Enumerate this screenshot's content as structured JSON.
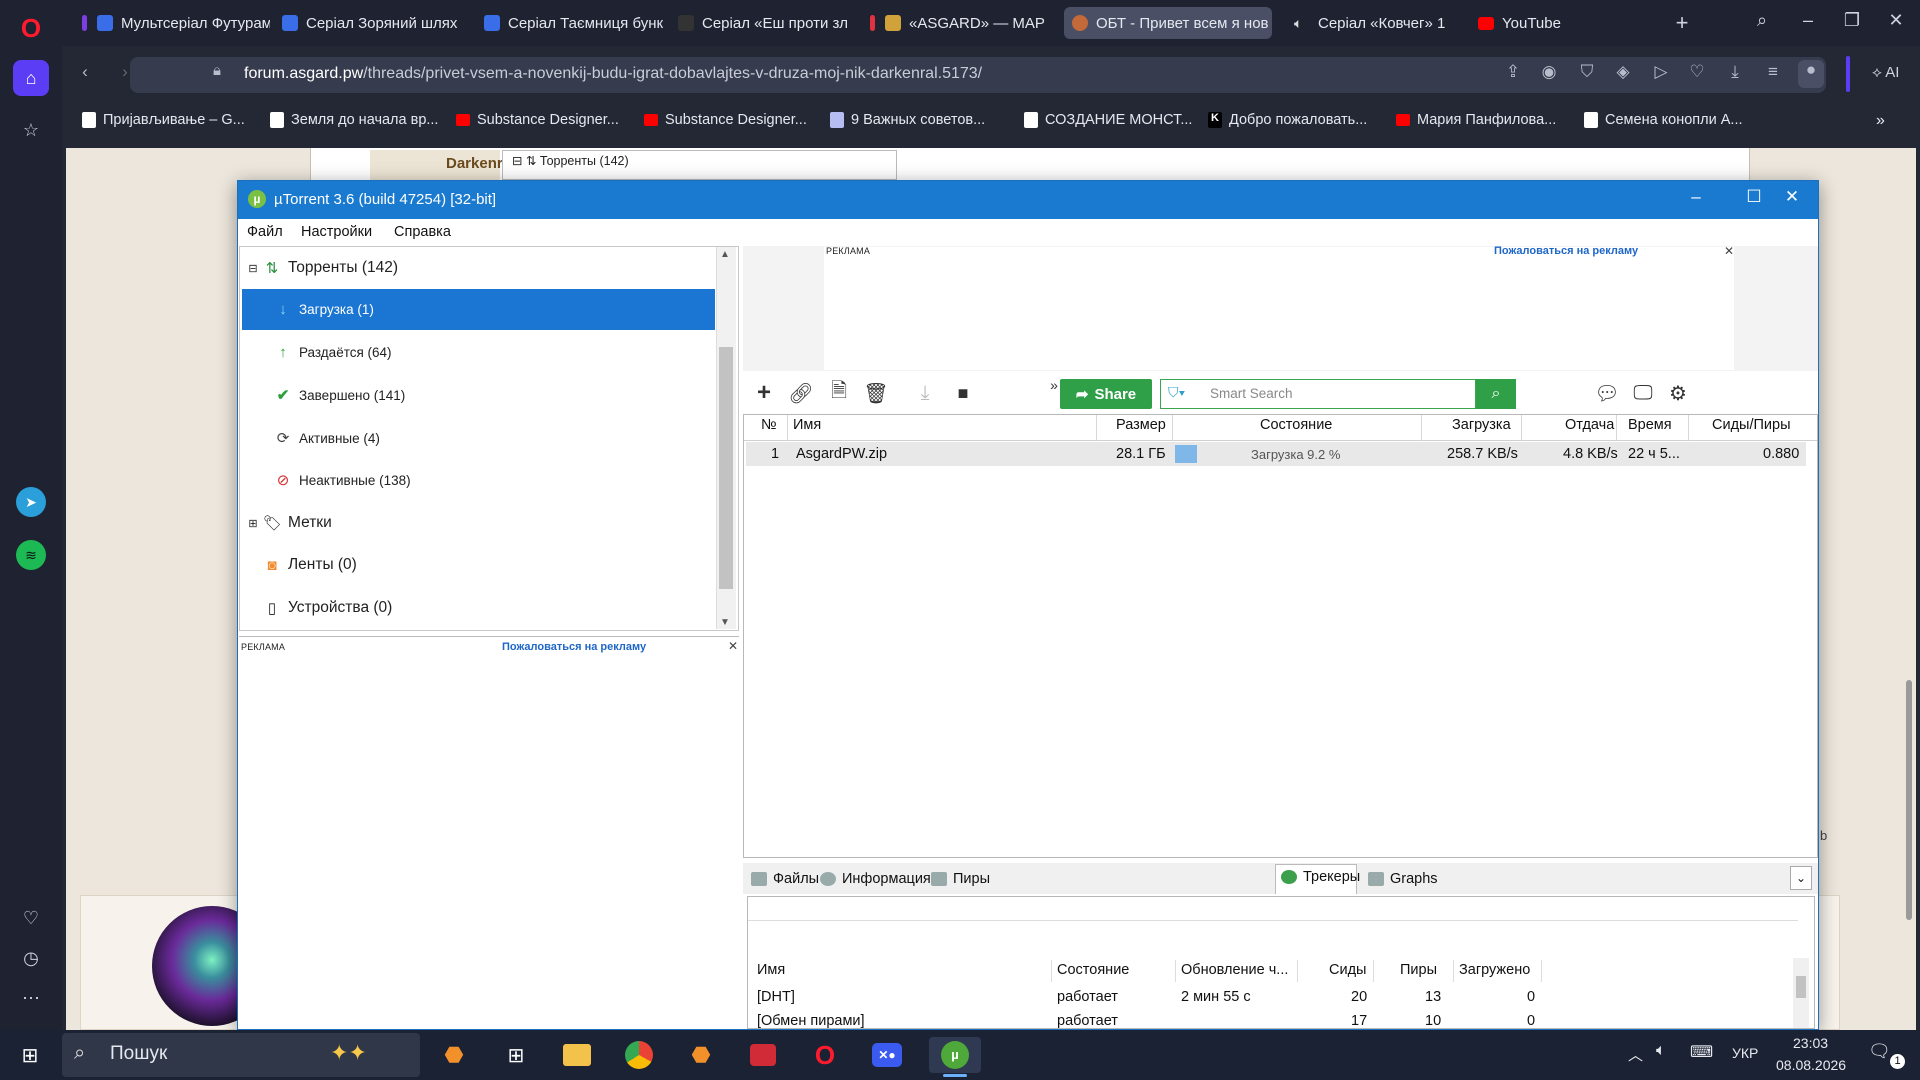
{
  "browser": {
    "tabs": [
      {
        "label": "Мультсеріал Футурама",
        "color": "#7b3fe4"
      },
      {
        "label": "Серіал Зоряний шлях",
        "color": "#3a6ee8"
      },
      {
        "label": "Серіал Таємниця бунк",
        "color": "#3a6ee8"
      },
      {
        "label": "Серіал «Еш проти зло",
        "color": "#333333"
      },
      {
        "label": "«ASGARD» — MAP",
        "color": "#d2a23a"
      },
      {
        "label": "ОБТ - Привет всем я нов",
        "color": "#c46a3a"
      },
      {
        "label": "Серіал «Ковчег» 1",
        "color": "#333333"
      },
      {
        "label": "YouTube",
        "color": "#ff0000"
      }
    ],
    "active_tab_index": 5,
    "url_domain": "forum.asgard.pw",
    "url_path": "/threads/privet-vsem-a-novenkij-budu-igrat-dobavlajtes-v-druza-moj-nik-darkenral.5173/",
    "ai_label": "AI",
    "bookmarks": [
      {
        "label": "Пријављивање – G...",
        "color": "#ffffff"
      },
      {
        "label": "Земля до начала вр...",
        "color": "#ffffff"
      },
      {
        "label": "Substance Designer...",
        "color": "#ff0000"
      },
      {
        "label": "Substance Designer...",
        "color": "#ff0000"
      },
      {
        "label": "9 Важных советов...",
        "color": "#b6bdf0"
      },
      {
        "label": "СОЗДАНИЕ МОНСТ...",
        "color": "#ffffff"
      },
      {
        "label": "Добро пожаловать...",
        "color": "#ffffff"
      },
      {
        "label": "Мария Панфилова...",
        "color": "#ff0000"
      },
      {
        "label": "Семена конопли А...",
        "color": "#ffffff"
      }
    ],
    "page_fragment": {
      "name": "Darkenr",
      "tree_label": "Торренты (142)",
      "edge_letter": "b"
    }
  },
  "utorrent": {
    "title": "µTorrent 3.6  (build 47254) [32-bit]",
    "menu": [
      "Файл",
      "Настройки",
      "Справка"
    ],
    "tree": {
      "torrents": "Торренты (142)",
      "downloading": "Загрузка (1)",
      "seeding": "Раздаётся (64)",
      "completed": "Завершено (141)",
      "active": "Активные (4)",
      "inactive": "Неактивные (138)",
      "labels": "Метки",
      "feeds": "Ленты (0)",
      "devices": "Устройства (0)"
    },
    "ad": {
      "tag": "РЕКЛАМА",
      "complain": "Пожаловаться на рекламу"
    },
    "toolbar": {
      "share": "Share",
      "search_placeholder": "Smart Search"
    },
    "columns": [
      "№",
      "Имя",
      "Размер",
      "Состояние",
      "Загрузка",
      "Отдача",
      "Время",
      "Сиды/Пиры"
    ],
    "rows": [
      {
        "num": "1",
        "name": "AsgardPW.zip",
        "size": "28.1 ГБ",
        "status": "Загрузка 9.2 %",
        "progress": 0.092,
        "down": "258.7 KB/s",
        "up": "4.8 KB/s",
        "time": "22 ч 5...",
        "ratio": "0.880"
      }
    ],
    "bottom_tabs": [
      "Файлы",
      "Информация",
      "Пиры",
      "Трекеры",
      "Graphs"
    ],
    "active_bottom_tab": "Трекеры",
    "trackers_columns": [
      "Имя",
      "Состояние",
      "Обновление ч...",
      "Сиды",
      "Пиры",
      "Загружено"
    ],
    "trackers": [
      {
        "name": "[DHT]",
        "status": "работает",
        "update": "2 мин 55 с",
        "seeds": "20",
        "peers": "13",
        "downloaded": "0"
      },
      {
        "name": "[Обмен пирами]",
        "status": "работает",
        "update": "",
        "seeds": "17",
        "peers": "10",
        "downloaded": "0"
      }
    ]
  },
  "taskbar": {
    "search": "Пошук",
    "lang": "УКР",
    "time": "23:03",
    "date": "08.08.2026",
    "notif_count": "1"
  }
}
